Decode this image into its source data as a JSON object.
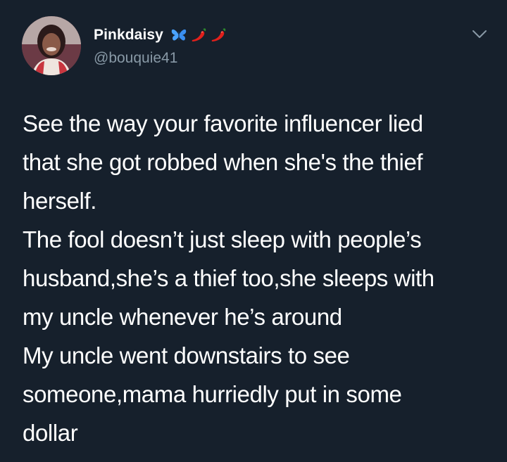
{
  "tweet": {
    "author": {
      "display_name": "Pinkdaisy",
      "handle": "@bouquie41",
      "emojis": [
        "butterfly-emoji",
        "chili-pepper-emoji",
        "chili-pepper-emoji"
      ]
    },
    "menu_icon": "chevron-down-icon",
    "text_lines": [
      "See the way your favorite influencer  lied",
      "that she got robbed when she's the thief",
      "herself.",
      "The fool doesn’t just sleep with people’s",
      "husband,she’s a thief too,she sleeps with",
      "my uncle whenever he’s around",
      "My uncle went downstairs to see",
      "someone,mama hurriedly put in some",
      "dollar"
    ]
  },
  "colors": {
    "background": "#16202c",
    "text_primary": "#ffffff",
    "text_secondary": "#8899a6",
    "butterfly": "#4aa3ff",
    "chili": "#e0201b"
  }
}
